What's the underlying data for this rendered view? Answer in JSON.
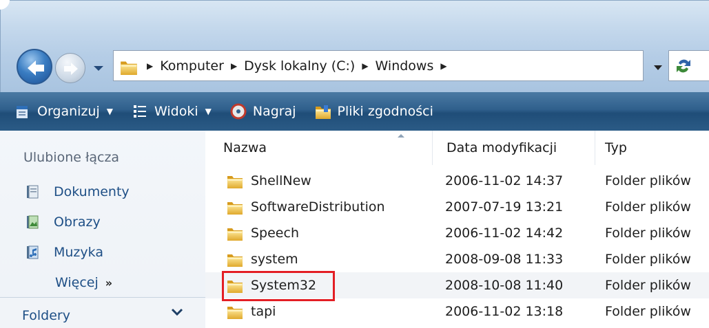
{
  "navigation": {
    "back_icon": "back-arrow-icon",
    "forward_icon": "forward-arrow-icon",
    "recent_icon": "chevron-down-icon"
  },
  "address_bar": {
    "folder_icon": "folder-icon",
    "crumbs": [
      "Komputer",
      "Dysk lokalny (C:)",
      "Windows"
    ]
  },
  "toolbar": {
    "organize": "Organizuj",
    "views": "Widoki",
    "burn": "Nagraj",
    "compat": "Pliki zgodności"
  },
  "nav_pane": {
    "favorites_title": "Ulubione łącza",
    "links": [
      "Dokumenty",
      "Obrazy",
      "Muzyka"
    ],
    "more": "Więcej",
    "more_arrows": "»",
    "folders": "Foldery"
  },
  "file_list": {
    "columns": [
      "Nazwa",
      "Data modyfikacji",
      "Typ"
    ],
    "rows": [
      {
        "name": "ShellNew",
        "date": "2006-11-02 14:37",
        "type": "Folder plików"
      },
      {
        "name": "SoftwareDistribution",
        "date": "2007-07-19 13:21",
        "type": "Folder plików"
      },
      {
        "name": "Speech",
        "date": "2006-11-02 14:42",
        "type": "Folder plików"
      },
      {
        "name": "system",
        "date": "2008-09-08 11:33",
        "type": "Folder plików"
      },
      {
        "name": "System32",
        "date": "2008-10-08 11:40",
        "type": "Folder plików"
      },
      {
        "name": "tapi",
        "date": "2006-11-02 13:18",
        "type": "Folder plików"
      }
    ],
    "highlighted_row": "System32",
    "highlight_color": "#e31e24"
  }
}
